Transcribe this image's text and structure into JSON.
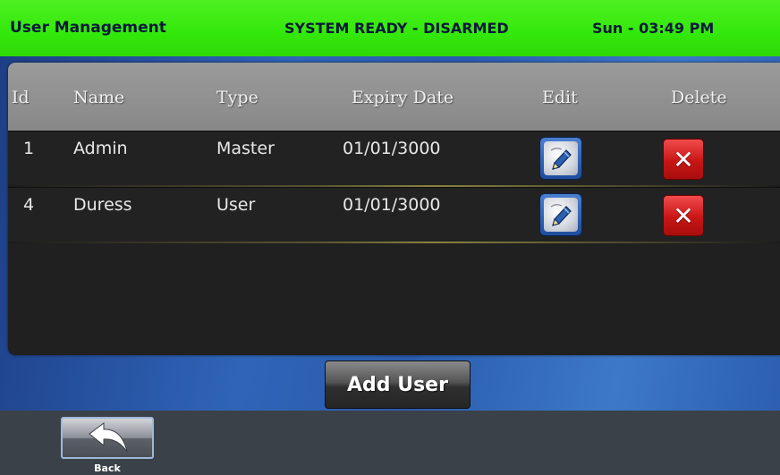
{
  "header": {
    "title": "User Management",
    "status": "SYSTEM READY - DISARMED",
    "clock": "Sun - 03:49 PM"
  },
  "table": {
    "columns": [
      "Id",
      "Name",
      "Type",
      "Expiry Date",
      "Edit",
      "Delete"
    ],
    "rows": [
      {
        "id": "1",
        "name": "Admin",
        "type": "Master",
        "expiry": "01/01/3000",
        "edit_icon": "pencil-edit-icon",
        "delete_icon": "close-x-icon"
      },
      {
        "id": "4",
        "name": "Duress",
        "type": "User",
        "expiry": "01/01/3000",
        "edit_icon": "pencil-edit-icon",
        "delete_icon": "close-x-icon"
      }
    ]
  },
  "actions": {
    "add_user_label": "Add User"
  },
  "footer": {
    "back_label": "Back",
    "back_icon": "back-arrow-icon"
  },
  "colors": {
    "header_bg": "#33e80b",
    "header_text": "#08183a",
    "delete_red": "#d41a1a",
    "edit_blue": "#2f5fae"
  }
}
